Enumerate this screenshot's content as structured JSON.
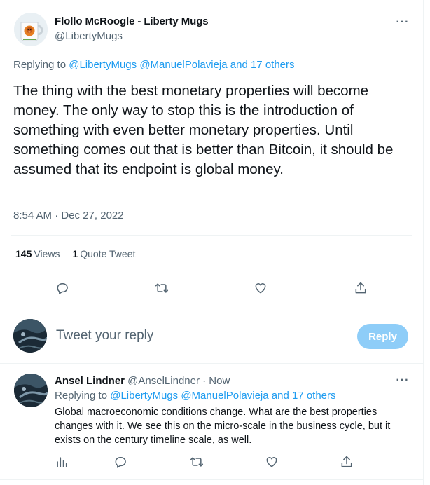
{
  "main_tweet": {
    "author_name": "Flollo McRoogle - Liberty Mugs",
    "author_handle": "@LibertyMugs",
    "replying_prefix": "Replying to ",
    "replying_mentions": "@LibertyMugs @ManuelPolavieja and 17 others",
    "text": "The thing with the best monetary properties will become money. The only way to stop this is the introduction of something with even better monetary properties. Until something comes out that is better than Bitcoin, it should be assumed that its endpoint is global money.",
    "timestamp": "8:54 AM · Dec 27, 2022",
    "views_count": "145",
    "views_label": "Views",
    "quotes_count": "1",
    "quotes_label": "Quote Tweet",
    "more_label": "···"
  },
  "composer": {
    "placeholder": "Tweet your reply",
    "reply_button": "Reply"
  },
  "reply_tweet": {
    "author_name": "Ansel Lindner",
    "meta": " @AnselLindner · Now",
    "replying_prefix": "Replying to ",
    "replying_mentions": "@LibertyMugs @ManuelPolavieja and 17 others",
    "text": "Global macroeconomic conditions change. What are the best properties changes with it. We see this on the micro-scale in the business cycle, but it exists on the century timeline scale, as well.",
    "more_label": "···"
  },
  "icons": {
    "reply": "reply-icon",
    "retweet": "retweet-icon",
    "like": "heart-icon",
    "share": "share-icon",
    "analytics": "analytics-icon"
  },
  "colors": {
    "accent": "#1d9bf0",
    "reply_button_disabled": "#8ecdf8",
    "muted_text": "#536471",
    "primary_text": "#0f1419"
  }
}
